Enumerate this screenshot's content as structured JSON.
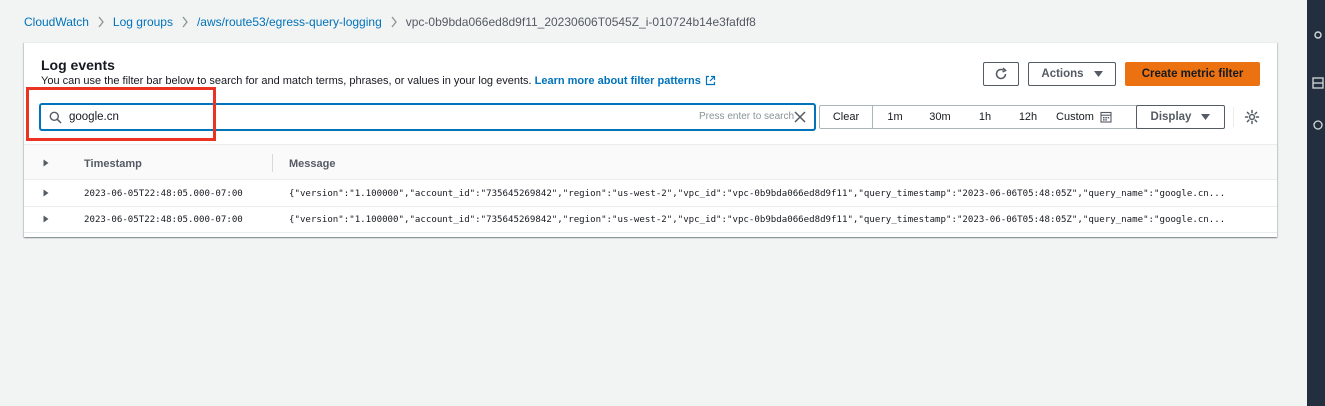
{
  "breadcrumbs": [
    {
      "label": "CloudWatch"
    },
    {
      "label": "Log groups"
    },
    {
      "label": "/aws/route53/egress-query-logging"
    },
    {
      "label": "vpc-0b9bda066ed8d9f11_20230606T0545Z_i-010724b14e3fafdf8"
    }
  ],
  "panel": {
    "title": "Log events",
    "description": "You can use the filter bar below to search for and match terms, phrases, or values in your log events.",
    "learn_more": "Learn more about filter patterns"
  },
  "toolbar": {
    "refresh_icon": "refresh-icon",
    "actions_label": "Actions",
    "create_metric_filter_label": "Create metric filter"
  },
  "search": {
    "value": "google.cn",
    "hint": "Press enter to search"
  },
  "time_range": {
    "clear_label": "Clear",
    "options": [
      "1m",
      "30m",
      "1h",
      "12h"
    ],
    "custom_label": "Custom"
  },
  "display_label": "Display",
  "table": {
    "columns": [
      "Timestamp",
      "Message"
    ],
    "rows": [
      {
        "timestamp": "2023-06-05T22:48:05.000-07:00",
        "message": "{\"version\":\"1.100000\",\"account_id\":\"735645269842\",\"region\":\"us-west-2\",\"vpc_id\":\"vpc-0b9bda066ed8d9f11\",\"query_timestamp\":\"2023-06-06T05:48:05Z\",\"query_name\":\"google.cn..."
      },
      {
        "timestamp": "2023-06-05T22:48:05.000-07:00",
        "message": "{\"version\":\"1.100000\",\"account_id\":\"735645269842\",\"region\":\"us-west-2\",\"vpc_id\":\"vpc-0b9bda066ed8d9f11\",\"query_timestamp\":\"2023-06-06T05:48:05Z\",\"query_name\":\"google.cn..."
      }
    ]
  },
  "colors": {
    "link": "#0073bb",
    "primary_button": "#ec7211",
    "highlight_annotation": "#ea3323",
    "right_strip": "#232f3e"
  }
}
